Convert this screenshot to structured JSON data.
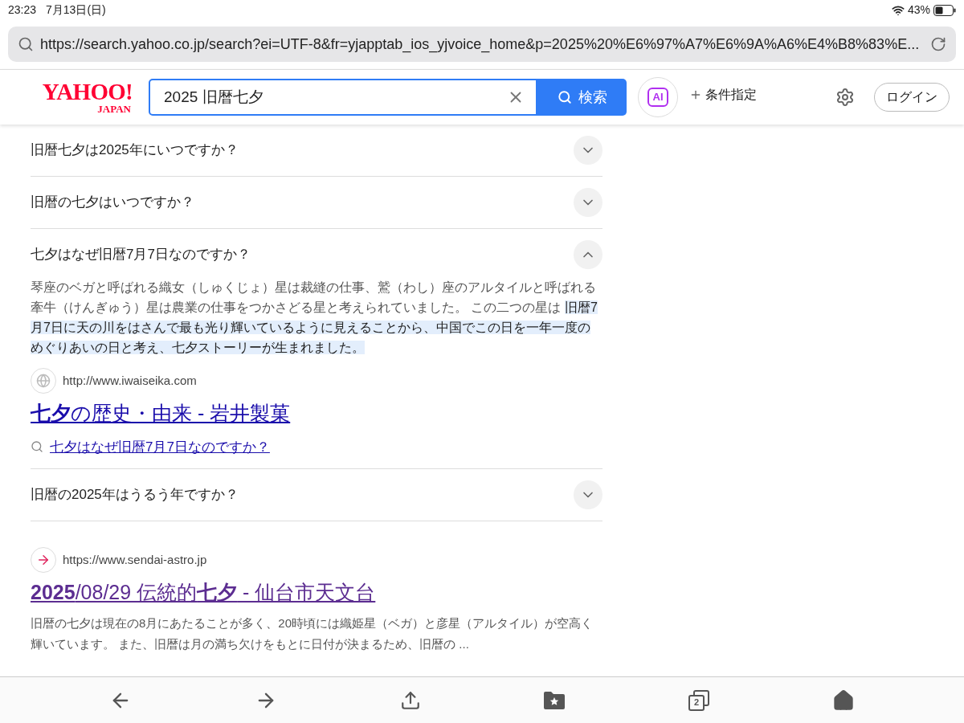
{
  "status_bar": {
    "time": "23:23",
    "date": "7月13日(日)",
    "battery": "43%"
  },
  "address_bar": {
    "url": "https://search.yahoo.co.jp/search?ei=UTF-8&fr=yjapptab_ios_yjvoice_home&p=2025%20%E6%97%A7%E6%9A%A6%E4%B8%83%E..."
  },
  "header": {
    "logo": "YAHOO!",
    "logo_sub": "JAPAN",
    "query": "2025 旧暦七夕",
    "search_button": "検索",
    "ai_label": "AI",
    "conditions": "条件指定",
    "login": "ログイン"
  },
  "faq": [
    {
      "question": "旧暦七夕は2025年にいつですか？",
      "expanded": false
    },
    {
      "question": "旧暦の七夕はいつですか？",
      "expanded": false
    },
    {
      "question": "七夕はなぜ旧暦7月7日なのですか？",
      "expanded": true,
      "answer": "琴座のベガと呼ばれる織女（しゅくじょ）星は裁縫の仕事、鷲（わし）座のアルタイルと呼ばれる牽牛（けんぎゅう）星は農業の仕事をつかさどる星と考えられていました。 この二つの星は ",
      "answer_highlighted": "旧暦7月7日に天の川をはさんで最も光り輝いているように見えることから、中国でこの日を一年一度のめぐりあいの日と考え、七夕ストーリーが生まれました。",
      "source_url": "http://www.iwaiseika.com",
      "source_title": "**七夕**の歴史・由来 - 岩井製菓",
      "related": "七夕はなぜ旧暦7月7日なのですか？"
    },
    {
      "question": "旧暦の2025年はうるう年ですか？",
      "expanded": false
    }
  ],
  "result": {
    "url": "https://www.sendai-astro.jp",
    "title": "**2025**/08/29 伝統的**七夕** - 仙台市天文台",
    "visited": true,
    "snippet": "旧暦の七夕は現在の8月にあたることが多く、20時頃には織姫星（ベガ）と彦星（アルタイル）が空高く輝いています。 また、旧暦は月の満ち欠けをもとに日付が決まるため、旧暦の ..."
  },
  "toolbar": {
    "tab_count": "2"
  }
}
